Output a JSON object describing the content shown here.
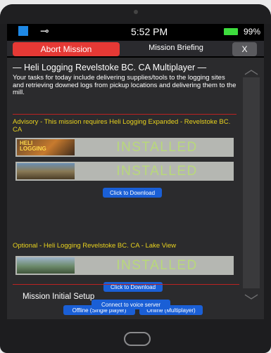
{
  "status_bar": {
    "time": "5:52 PM",
    "battery_percent": "99%",
    "battery_color": "#3ddc3d",
    "app_icon": "app-icon",
    "charging_icon": "plug-icon"
  },
  "header": {
    "abort_label": "Abort Mission",
    "title": "Mission Briefing",
    "close_label": "X",
    "abort_color": "#e53935"
  },
  "briefing": {
    "heading": "— Heli Logging Revelstoke BC. CA Multiplayer —",
    "description": "Your tasks for today include delivering supplies/tools to the logging sites and retrieving downed logs from pickup locations and delivering them to the mill.",
    "advisory": "Advisory - This mission requires Heli Logging Expanded - Revelstoke BC. CA",
    "mods": [
      {
        "thumb_text": "HELI LOGGING",
        "status": "INSTALLED"
      },
      {
        "thumb_text": "",
        "status": "INSTALLED"
      }
    ],
    "download_label": "Click to Download",
    "optional": "Optional - Heli Logging Revelstoke BC. CA - Lake View",
    "optional_mod": {
      "status": "INSTALLED"
    },
    "download_label_2": "Click to Download"
  },
  "setup": {
    "title": "Mission Initial Setup",
    "offline_label": "Offline (Single player)",
    "online_label": "Online (Multiplayer)",
    "voice_label": "Connect to voice server"
  },
  "colors": {
    "accent_yellow": "#e8d21e",
    "installed_green": "#b8d87a",
    "button_blue": "#1a5fd6"
  }
}
